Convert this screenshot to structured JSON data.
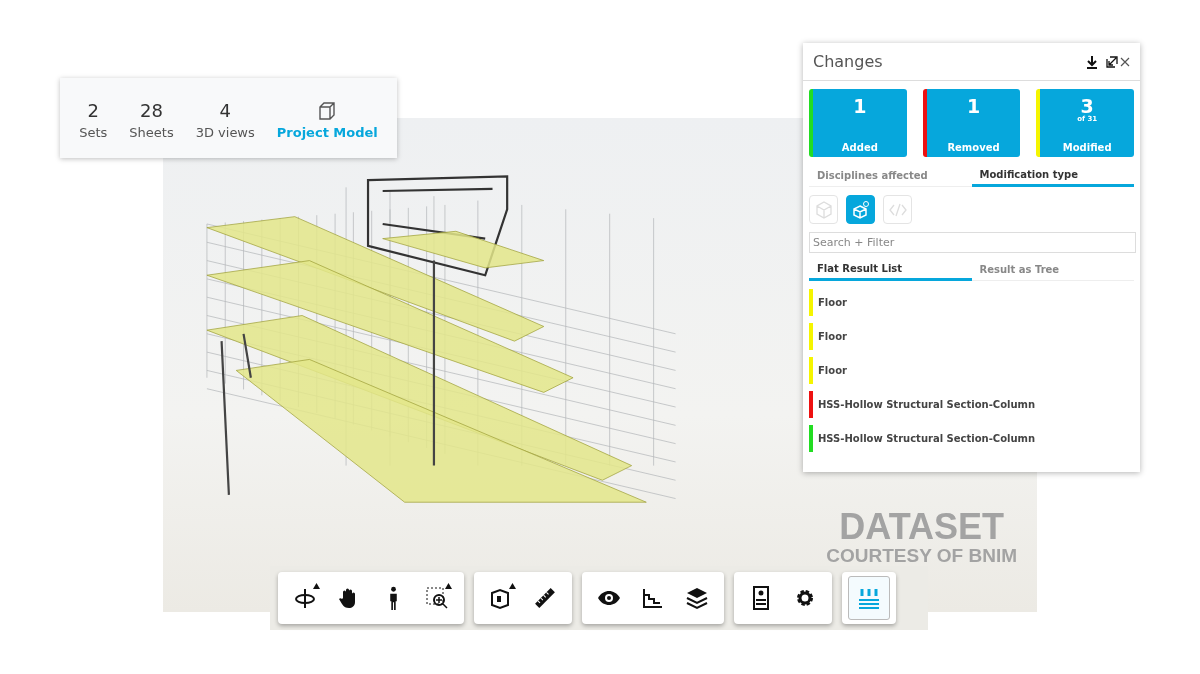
{
  "stats_card": {
    "items": [
      {
        "kind": "count",
        "value": "2",
        "label": "Sets"
      },
      {
        "kind": "count",
        "value": "28",
        "label": "Sheets"
      },
      {
        "kind": "count",
        "value": "4",
        "label": "3D views"
      },
      {
        "kind": "model",
        "label": "Project Model"
      }
    ]
  },
  "viewport": {
    "credit": [
      "DATASET",
      "COURTESY OF BNIM"
    ]
  },
  "changes_panel": {
    "title": "Changes",
    "tiles": [
      {
        "count": "1",
        "label": "Added",
        "color": "#22dd22"
      },
      {
        "count": "1",
        "label": "Removed",
        "color": "#ee1111"
      },
      {
        "count": "3",
        "sub": "of 31",
        "label": "Modified",
        "color": "#f5f500"
      }
    ],
    "tabs": [
      {
        "label": "Disciplines affected",
        "selected": false
      },
      {
        "label": "Modification type",
        "selected": true
      }
    ],
    "filters": [
      {
        "kind": "cube",
        "selected": false
      },
      {
        "kind": "modified",
        "selected": true
      },
      {
        "kind": "code",
        "selected": false
      }
    ],
    "search": {
      "placeholder": "Search + Filter"
    },
    "result_tabs": [
      {
        "label": "Flat Result List",
        "selected": true
      },
      {
        "label": "Result as Tree",
        "selected": false
      }
    ],
    "results": [
      {
        "name": "Floor",
        "color": "#f5f500"
      },
      {
        "name": "Floor",
        "color": "#f5f500"
      },
      {
        "name": "Floor",
        "color": "#f5f500"
      },
      {
        "name": "HSS-Hollow Structural Section-Column",
        "color": "#ee1111"
      },
      {
        "name": "HSS-Hollow Structural Section-Column",
        "color": "#22dd22"
      }
    ]
  },
  "toolbar": {
    "groups": [
      [
        {
          "kind": "orbit",
          "has_menu": true,
          "selected": false
        },
        {
          "kind": "pan",
          "has_menu": false,
          "selected": false
        },
        {
          "kind": "walk",
          "has_menu": false,
          "selected": false
        },
        {
          "kind": "zoom",
          "has_menu": true,
          "selected": false
        }
      ],
      [
        {
          "kind": "section",
          "has_menu": true,
          "selected": false
        },
        {
          "kind": "measure",
          "has_menu": false,
          "selected": false
        }
      ],
      [
        {
          "kind": "eye",
          "has_menu": false,
          "selected": false
        },
        {
          "kind": "stairs",
          "has_menu": false,
          "selected": false
        },
        {
          "kind": "layers",
          "has_menu": false,
          "selected": false
        }
      ],
      [
        {
          "kind": "properties",
          "has_menu": false,
          "selected": false
        },
        {
          "kind": "settings",
          "has_menu": false,
          "selected": false
        }
      ],
      [
        {
          "kind": "browser",
          "has_menu": false,
          "selected": true
        }
      ]
    ]
  }
}
